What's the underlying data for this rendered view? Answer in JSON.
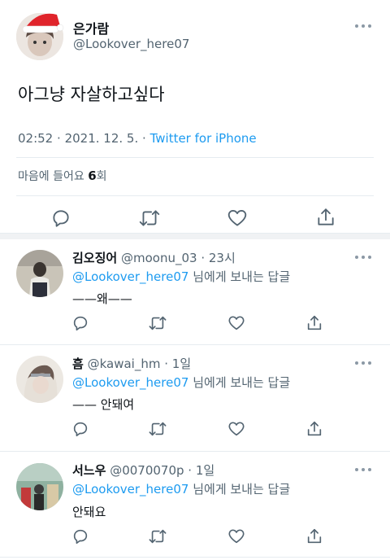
{
  "tweet": {
    "display_name": "은가람",
    "handle": "@Lookover_here07",
    "text": "아그냥 자살하고싶다",
    "time": "02:52",
    "sep1": "·",
    "date": "2021. 12. 5.",
    "sep2": "·",
    "client": "Twitter for iPhone",
    "likes_label_pre": "마음에 들어요",
    "likes_count": "6",
    "likes_label_post": "회"
  },
  "replies": [
    {
      "name": "김오징어",
      "handle": "@moonu_03",
      "time": "· 23시",
      "reply_to_handle": "@Lookover_here07",
      "reply_to_suffix": "님에게 보내는 답글",
      "text": "——왜——"
    },
    {
      "name": "흠",
      "handle": "@kawai_hm",
      "time": "· 1일",
      "reply_to_handle": "@Lookover_here07",
      "reply_to_suffix": "님에게 보내는 답글",
      "text": "—— 안돼여"
    },
    {
      "name": "서느우",
      "handle": "@0070070p",
      "time": "· 1일",
      "reply_to_handle": "@Lookover_here07",
      "reply_to_suffix": "님에게 보내는 답글",
      "text": "안돼요"
    }
  ],
  "icons": {
    "reply": "reply-icon",
    "retweet": "retweet-icon",
    "like": "heart-icon",
    "share": "share-icon",
    "more": "more-icon"
  },
  "colors": {
    "link": "#1d9bf0",
    "muted": "#536471",
    "santa_hat": "#e0242b"
  }
}
